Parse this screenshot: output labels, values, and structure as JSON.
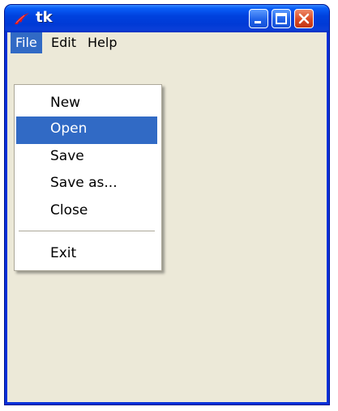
{
  "window": {
    "title": "tk",
    "controls": [
      "minimize-icon",
      "maximize-icon",
      "close-icon"
    ],
    "title_bar_color": "#0a5ef7",
    "client_color": "#ece9d8"
  },
  "menubar": {
    "items": [
      {
        "label": "File",
        "active": true
      },
      {
        "label": "Edit",
        "active": false
      },
      {
        "label": "Help",
        "active": false
      }
    ]
  },
  "file_menu": {
    "items": [
      {
        "label": "New"
      },
      {
        "label": "Open",
        "highlighted": true
      },
      {
        "label": "Save"
      },
      {
        "label": "Save as..."
      },
      {
        "label": "Close"
      }
    ],
    "exit_label": "Exit",
    "highlight_color": "#316ac5"
  }
}
